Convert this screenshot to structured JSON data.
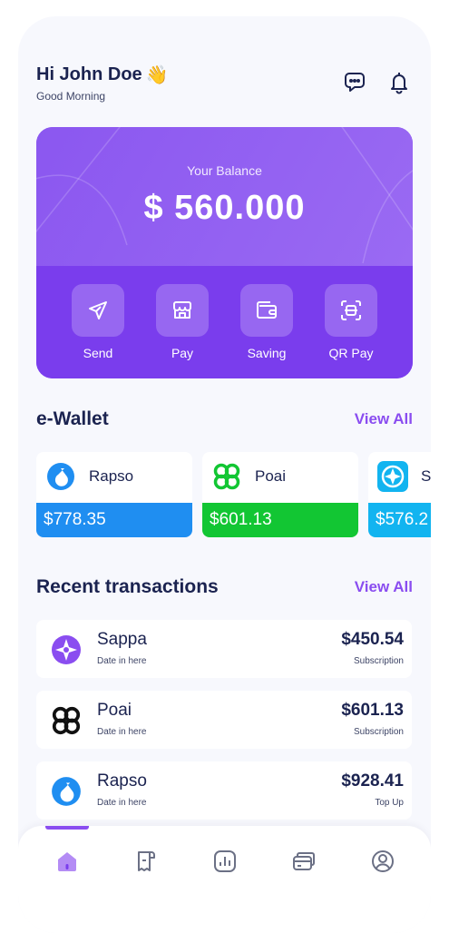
{
  "header": {
    "greeting": "Hi John Doe",
    "wave_emoji": "👋",
    "subtitle": "Good Morning",
    "chat_icon": "chat-bubbles-icon",
    "bell_icon": "bell-icon"
  },
  "balance": {
    "label": "Your Balance",
    "value": "$ 560.000"
  },
  "actions": [
    {
      "label": "Send",
      "icon": "send-icon"
    },
    {
      "label": "Pay",
      "icon": "store-icon"
    },
    {
      "label": "Saving",
      "icon": "wallet-icon"
    },
    {
      "label": "QR Pay",
      "icon": "qr-scan-icon"
    }
  ],
  "ewallet": {
    "title": "e-Wallet",
    "view_all": "View All",
    "items": [
      {
        "name": "Rapso",
        "balance": "$778.35",
        "color": "#1f8ef1"
      },
      {
        "name": "Poai",
        "balance": "$601.13",
        "color": "#12c633"
      },
      {
        "name": "S",
        "balance": "$576.2",
        "color": "#12b4f0"
      }
    ]
  },
  "transactions": {
    "title": "Recent transactions",
    "view_all": "View All",
    "items": [
      {
        "name": "Sappa",
        "date": "Date in here",
        "amount": "$450.54",
        "type": "Subscription"
      },
      {
        "name": "Poai",
        "date": "Date in here",
        "amount": "$601.13",
        "type": "Subscription"
      },
      {
        "name": "Rapso",
        "date": "Date in here",
        "amount": "$928.41",
        "type": "Top Up"
      }
    ]
  },
  "nav": {
    "items": [
      "home-icon",
      "receipt-icon",
      "analytics-icon",
      "cards-icon",
      "profile-icon"
    ],
    "active": "home-icon"
  },
  "colors": {
    "accent": "#8a4df0",
    "card": "#7b3ff0",
    "text": "#1b2350"
  }
}
